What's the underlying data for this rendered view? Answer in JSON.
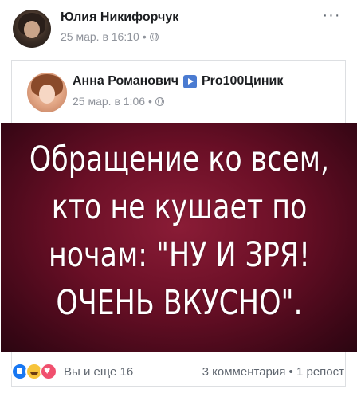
{
  "post": {
    "author": "Юлия Никифорчук",
    "date": "25 мар. в 16:10",
    "more_label": "···"
  },
  "shared": {
    "author": "Анна Романович",
    "channel": "Pro100Циник",
    "date": "25 мар. в 1:06",
    "image_lines": [
      "Обращение ко всем,",
      "кто не кушает по",
      "ночам: \"НУ И ЗРЯ!",
      "ОЧЕНЬ ВКУСНО\"."
    ]
  },
  "footer": {
    "reactions_label": "Вы и еще 16",
    "counts": "3 комментария • 1 репост"
  },
  "icons": [
    "like-reaction-icon",
    "haha-reaction-icon",
    "love-reaction-icon",
    "globe-icon",
    "play-icon"
  ]
}
